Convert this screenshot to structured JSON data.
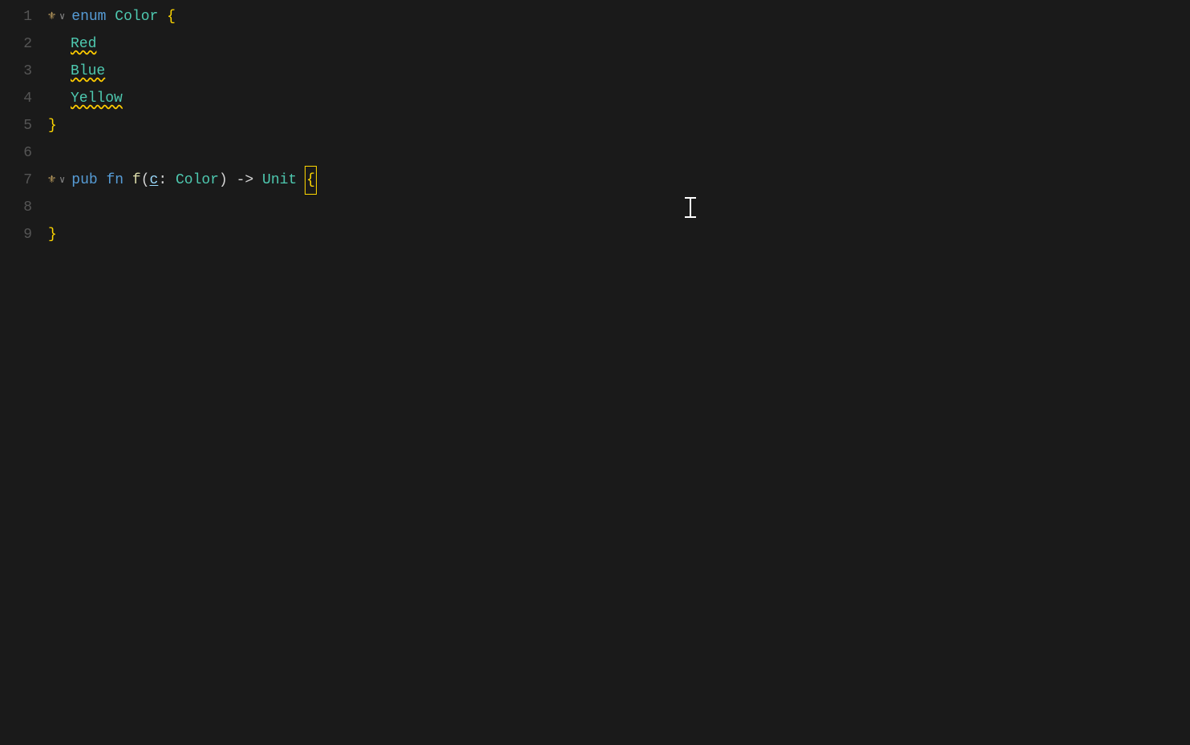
{
  "editor": {
    "background": "#1a1a1a",
    "lines": [
      {
        "number": 1,
        "content": "enum_color_open"
      },
      {
        "number": 2,
        "content": "red"
      },
      {
        "number": 3,
        "content": "blue"
      },
      {
        "number": 4,
        "content": "yellow"
      },
      {
        "number": 5,
        "content": "close_brace"
      },
      {
        "number": 6,
        "content": "empty"
      },
      {
        "number": 7,
        "content": "fn_signature"
      },
      {
        "number": 8,
        "content": "empty_body"
      },
      {
        "number": 9,
        "content": "close_fn"
      }
    ],
    "gutter_icon": "⚜",
    "chevron": "∨",
    "keywords": {
      "enum": "enum",
      "pub": "pub",
      "fn": "fn"
    },
    "identifiers": {
      "color_type": "Color",
      "fn_name": "f",
      "param_name": "c",
      "unit": "Unit",
      "red": "Red",
      "blue": "Blue",
      "yellow": "Yellow"
    },
    "symbols": {
      "open_brace": "{",
      "close_brace": "}",
      "colon": ":",
      "arrow": "->",
      "open_paren": "(",
      "close_paren": ")"
    }
  }
}
